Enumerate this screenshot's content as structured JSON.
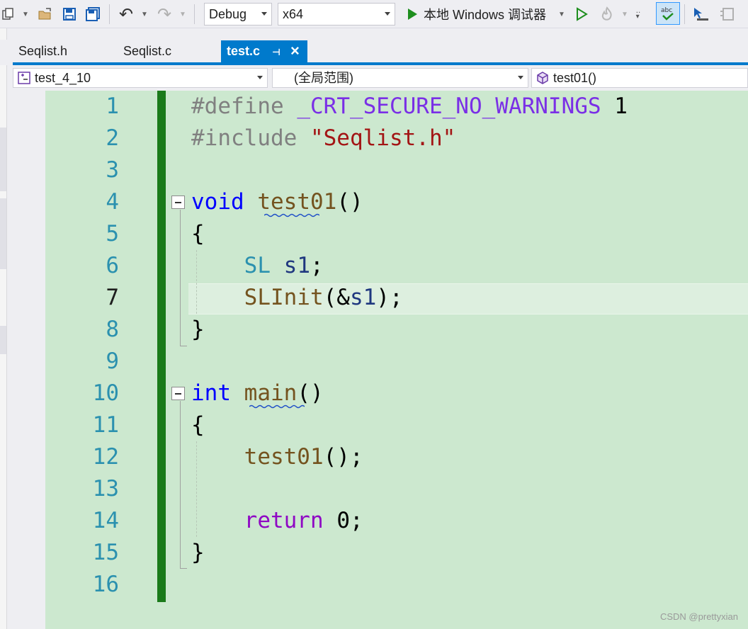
{
  "toolbar": {
    "config": "Debug",
    "platform": "x64",
    "run_label": "本地 Windows 调试器",
    "icons": [
      "new-project-icon",
      "open-folder-icon",
      "save-icon",
      "save-all-icon",
      "undo-icon",
      "redo-icon",
      "start-debug-icon",
      "start-without-debug-icon",
      "hot-reload-icon",
      "spell-check-icon",
      "solution-explorer-icon"
    ]
  },
  "tabs": [
    {
      "label": "Seqlist.h",
      "active": false
    },
    {
      "label": "Seqlist.c",
      "active": false
    },
    {
      "label": "test.c",
      "active": true
    }
  ],
  "navbar": {
    "project": "test_4_10",
    "scope": "(全局范围)",
    "member": "test01()"
  },
  "editor": {
    "current_line": 7,
    "lines": [
      {
        "n": "1"
      },
      {
        "n": "2"
      },
      {
        "n": "3"
      },
      {
        "n": "4"
      },
      {
        "n": "5"
      },
      {
        "n": "6"
      },
      {
        "n": "7"
      },
      {
        "n": "8"
      },
      {
        "n": "9"
      },
      {
        "n": "10"
      },
      {
        "n": "11"
      },
      {
        "n": "12"
      },
      {
        "n": "13"
      },
      {
        "n": "14"
      },
      {
        "n": "15"
      },
      {
        "n": "16"
      }
    ],
    "tokens": {
      "l1_define": "#define",
      "l1_macro": "_CRT_SECURE_NO_WARNINGS",
      "l1_value": "1",
      "l2_include": "#include",
      "l2_file": "\"Seqlist.h\"",
      "l4_void": "void",
      "l4_name": "test01",
      "l4_parens": "()",
      "l5_open": "{",
      "l6_type": "SL",
      "l6_var": "s1",
      "l6_semi": ";",
      "l7_fn": "SLInit",
      "l7_open": "(&",
      "l7_var": "s1",
      "l7_close": ");",
      "l8_close": "}",
      "l10_int": "int",
      "l10_name": "main",
      "l10_parens": "()",
      "l11_open": "{",
      "l12_fn": "test01",
      "l12_rest": "();",
      "l14_return": "return",
      "l14_zero": "0",
      "l14_semi": ";",
      "l15_close": "}"
    }
  },
  "watermark": "CSDN @prettyxian"
}
